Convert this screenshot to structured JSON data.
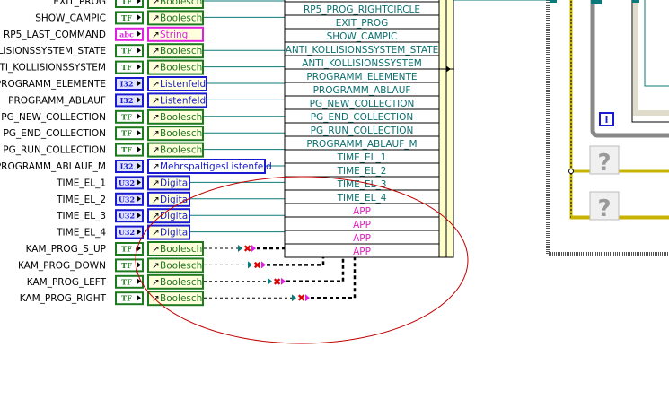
{
  "colors": {
    "boolean": "#1e7a1e",
    "boolean_fill": "#ffffcc",
    "string": "#e020e0",
    "numeric": "#1a1ad0",
    "wire": "#0b7a7a",
    "annotation_ellipse": "#c00000",
    "app_text": "#e020c0"
  },
  "controls": [
    {
      "label": "EXIT_PROG",
      "terminal": "TF",
      "type": "Boolesch",
      "kind": "bool",
      "wire": "solid"
    },
    {
      "label": "SHOW_CAMPIC",
      "terminal": "TF",
      "type": "Boolesch",
      "kind": "bool",
      "wire": "solid"
    },
    {
      "label": "RP5_LAST_COMMAND",
      "terminal": "abc",
      "type": "String",
      "kind": "str",
      "wire": "none"
    },
    {
      "label": "KOLLISIONSSYSTEM_STATE",
      "terminal": "TF",
      "type": "Boolesch",
      "kind": "bool",
      "wire": "solid"
    },
    {
      "label": "ANTI_KOLLISIONSSYSTEM",
      "terminal": "TF",
      "type": "Boolesch",
      "kind": "bool",
      "wire": "solid"
    },
    {
      "label": "PROGRAMM_ELEMENTE",
      "terminal": "I32",
      "type": "Listenfeld",
      "kind": "num",
      "wire": "solid"
    },
    {
      "label": "PROGRAMM_ABLAUF",
      "terminal": "I32",
      "type": "Listenfeld",
      "kind": "num",
      "wire": "solid"
    },
    {
      "label": "PG_NEW_COLLECTION",
      "terminal": "TF",
      "type": "Boolesch",
      "kind": "bool",
      "wire": "solid"
    },
    {
      "label": "PG_END_COLLECTION",
      "terminal": "TF",
      "type": "Boolesch",
      "kind": "bool",
      "wire": "solid"
    },
    {
      "label": "PG_RUN_COLLECTION",
      "terminal": "TF",
      "type": "Boolesch",
      "kind": "bool",
      "wire": "solid"
    },
    {
      "label": "PROGRAMM_ABLAUF_M",
      "terminal": "I32",
      "type": "MehrspaltigesListenfeld",
      "kind": "num",
      "wire": "solid"
    },
    {
      "label": "TIME_EL_1",
      "terminal": "U32",
      "type": "Digital",
      "kind": "num",
      "wire": "solid"
    },
    {
      "label": "TIME_EL_2",
      "terminal": "U32",
      "type": "Digital",
      "kind": "num",
      "wire": "solid"
    },
    {
      "label": "TIME_EL_3",
      "terminal": "U32",
      "type": "Digital",
      "kind": "num",
      "wire": "solid"
    },
    {
      "label": "TIME_EL_4",
      "terminal": "U32",
      "type": "Digital",
      "kind": "num",
      "wire": "solid"
    },
    {
      "label": "KAM_PROG_S_UP",
      "terminal": "TF",
      "type": "Boolesch",
      "kind": "bool",
      "wire": "broken"
    },
    {
      "label": "KAM_PROG_DOWN",
      "terminal": "TF",
      "type": "Boolesch",
      "kind": "bool",
      "wire": "broken"
    },
    {
      "label": "KAM_PROG_LEFT",
      "terminal": "TF",
      "type": "Boolesch",
      "kind": "bool",
      "wire": "broken"
    },
    {
      "label": "KAM_PROG_RIGHT",
      "terminal": "TF",
      "type": "Boolesch",
      "kind": "bool",
      "wire": "broken"
    }
  ],
  "bundle": {
    "elements": [
      "RP5_PROG_RIGHTCIRCLE",
      "EXIT_PROG",
      "SHOW_CAMPIC",
      "ANTI_KOLLISIONSSYSTEM_STATE",
      "ANTI_KOLLISIONSSYSTEM",
      "PROGRAMM_ELEMENTE",
      "PROGRAMM_ABLAUF",
      "PG_NEW_COLLECTION",
      "PG_END_COLLECTION",
      "PG_RUN_COLLECTION",
      "PROGRAMM_ABLAUF_M",
      "TIME_EL_1",
      "TIME_EL_2",
      "TIME_EL_3",
      "TIME_EL_4",
      "APP",
      "APP",
      "APP",
      "APP"
    ]
  },
  "loop": {
    "iteration_terminal": "i",
    "unknown_nodes": [
      "?",
      "?"
    ]
  }
}
